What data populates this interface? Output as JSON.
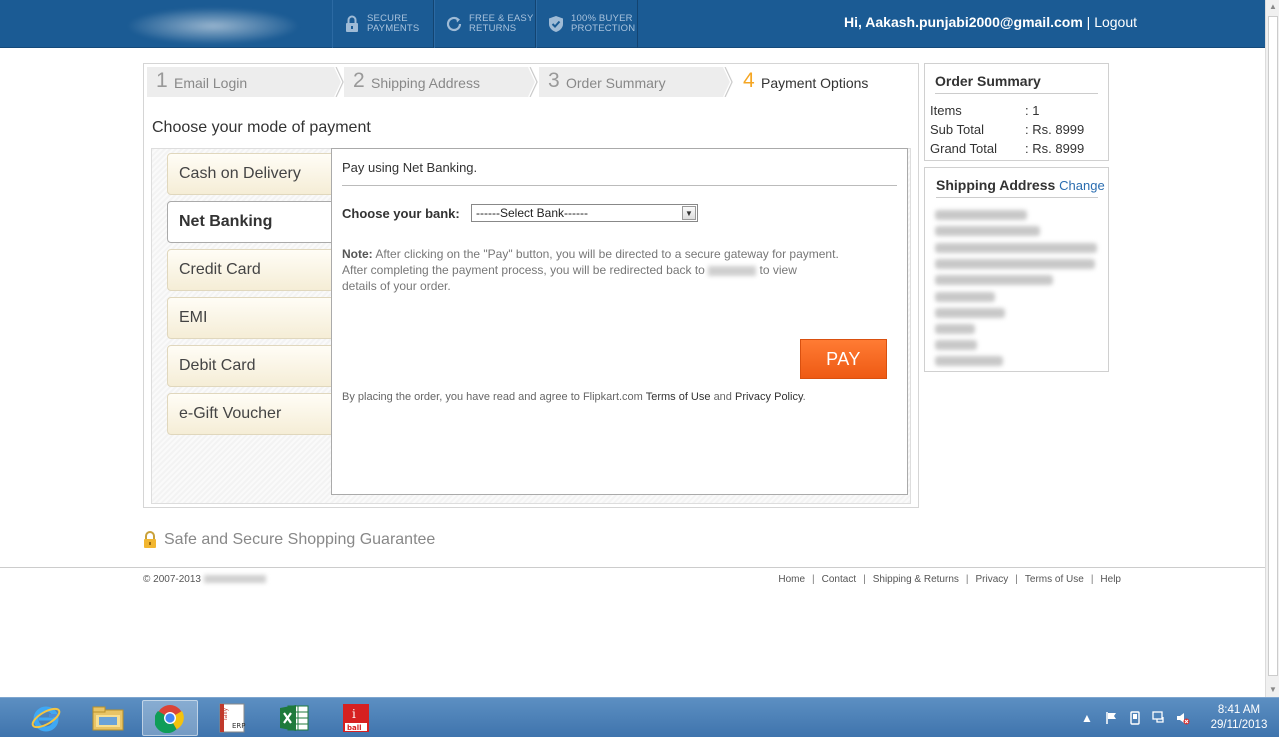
{
  "header": {
    "badges": [
      {
        "icon": "lock-icon",
        "line1": "SECURE",
        "line2": "PAYMENTS"
      },
      {
        "icon": "refresh-icon",
        "line1": "FREE & EASY",
        "line2": "RETURNS"
      },
      {
        "icon": "shield-check-icon",
        "line1": "100% BUYER",
        "line2": "PROTECTION"
      }
    ],
    "greeting": "Hi, Aakash.punjabi2000@gmail.com",
    "separator": "|",
    "logout": "Logout"
  },
  "steps": [
    {
      "num": "1",
      "label": "Email Login"
    },
    {
      "num": "2",
      "label": "Shipping Address"
    },
    {
      "num": "3",
      "label": "Order Summary"
    },
    {
      "num": "4",
      "label": "Payment Options",
      "active": true
    }
  ],
  "payment": {
    "title": "Choose your mode of payment",
    "methods": [
      "Cash on Delivery",
      "Net Banking",
      "Credit Card",
      "EMI",
      "Debit Card",
      "e-Gift Voucher"
    ],
    "selected": "Net Banking",
    "panel": {
      "title": "Pay using Net Banking.",
      "bank_label": "Choose your bank:",
      "bank_select": "------Select Bank------",
      "note_label": "Note:",
      "note_part1": "After clicking on the \"Pay\" button, you will be directed to a secure gateway for payment.",
      "note_part2a": "After completing the payment process, you will be redirected back to",
      "note_part2b": "to view",
      "note_part3": "details of your order.",
      "pay_button": "PAY",
      "agree_text": "By placing the order, you have read and agree to Flipkart.com",
      "terms": "Terms of Use",
      "and": "and",
      "privacy": "Privacy Policy",
      "period": "."
    }
  },
  "order_summary": {
    "title": "Order Summary",
    "rows": [
      {
        "key": "Items",
        "value": ": 1"
      },
      {
        "key": "Sub Total",
        "value": ": Rs. 8999"
      },
      {
        "key": "Grand Total",
        "value": ": Rs. 8999"
      }
    ]
  },
  "shipping": {
    "title": "Shipping Address",
    "change": "Change"
  },
  "guarantee": "Safe and Secure Shopping Guarantee",
  "footer": {
    "copyright": "© 2007-2013",
    "links": [
      "Home",
      "Contact",
      "Shipping & Returns",
      "Privacy",
      "Terms of Use",
      "Help"
    ],
    "sep": "|"
  },
  "taskbar": {
    "apps": [
      "internet-explorer-icon",
      "file-explorer-icon",
      "chrome-icon",
      "tally-erp-icon",
      "excel-icon",
      "iball-icon"
    ],
    "tally_text": "Tally ERP 9",
    "iball_text": "ball",
    "time": "8:41 AM",
    "date": "29/11/2013"
  }
}
